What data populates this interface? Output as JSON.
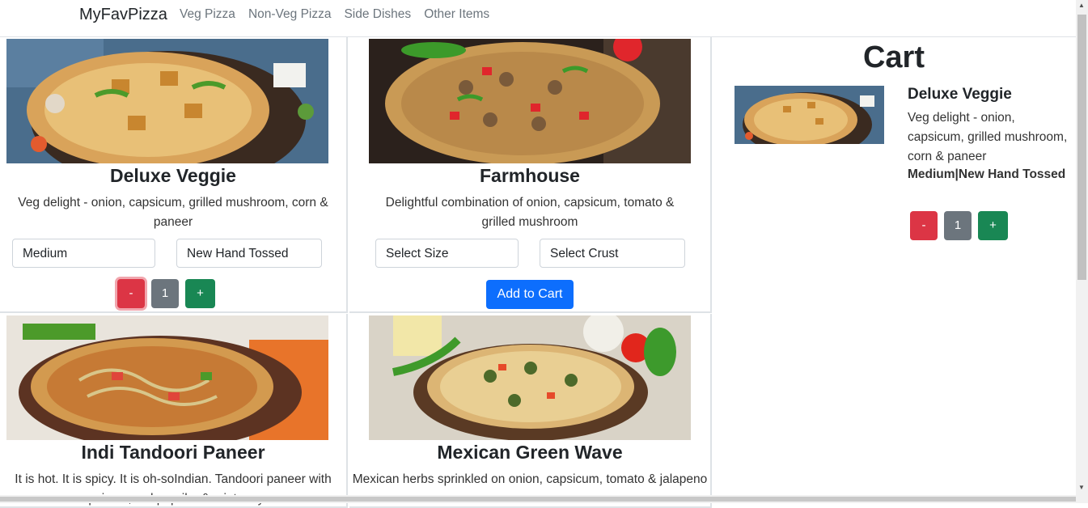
{
  "nav": {
    "brand": "MyFavPizza",
    "links": [
      "Veg Pizza",
      "Non-Veg Pizza",
      "Side Dishes",
      "Other Items"
    ]
  },
  "products": [
    {
      "title": "Deluxe Veggie",
      "description": "Veg delight - onion, capsicum, grilled mushroom, corn & paneer",
      "size": "Medium",
      "crust": "New Hand Tossed",
      "qty_minus": "-",
      "qty": "1",
      "qty_plus": "+"
    },
    {
      "title": "Farmhouse",
      "description": "Delightful combination of onion, capsicum, tomato & grilled mushroom",
      "size": "Select Size",
      "crust": "Select Crust",
      "add_label": "Add to Cart"
    },
    {
      "title": "Indi Tandoori Paneer",
      "description": "It is hot. It is spicy. It is oh-soIndian. Tandoori paneer with capsicum, red paprika & mint mayo"
    },
    {
      "title": "Mexican Green Wave",
      "description": "Mexican herbs sprinkled on onion, capsicum, tomato & jalapeno"
    }
  ],
  "cart": {
    "title": "Cart",
    "item": {
      "title": "Deluxe Veggie",
      "description": "Veg delight - onion, capsicum, grilled mushroom, corn & paneer",
      "options": "Medium|New Hand Tossed",
      "qty_minus": "-",
      "qty": "1",
      "qty_plus": "+"
    }
  },
  "colors": {
    "danger": "#dc3545",
    "secondary": "#6c757d",
    "success": "#198754",
    "primary": "#0d6efd"
  }
}
